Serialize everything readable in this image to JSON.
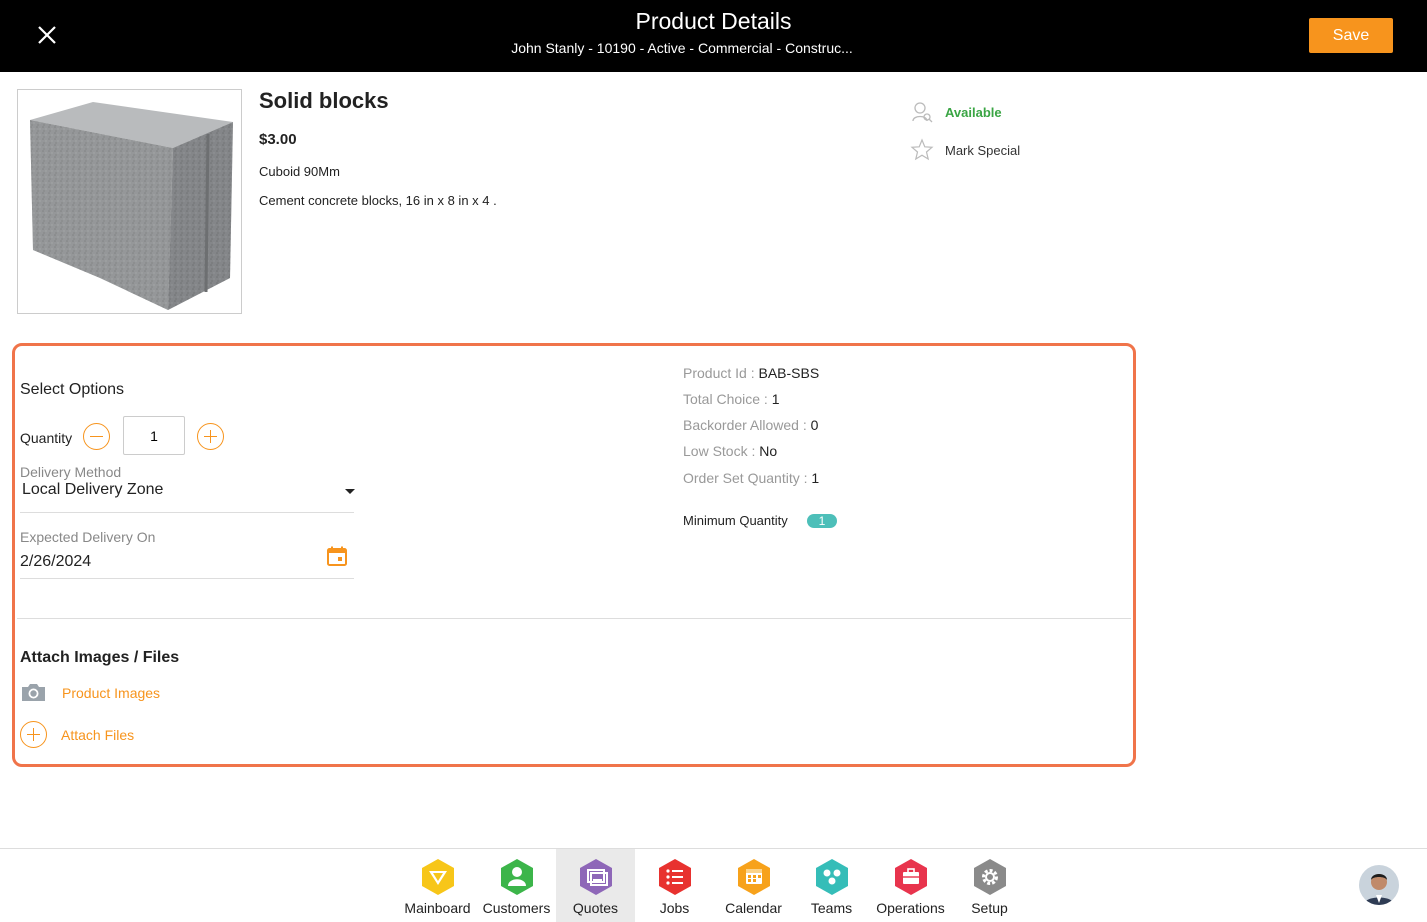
{
  "header": {
    "title": "Product Details",
    "subtitle": "John Stanly - 10190 - Active - Commercial - Construc...",
    "save_label": "Save",
    "close_icon": "close-icon"
  },
  "product": {
    "name": "Solid blocks",
    "price": "$3.00",
    "variant": "Cuboid 90Mm",
    "description": "Cement concrete blocks, 16 in x 8 in x 4 .",
    "availability": "Available",
    "mark_special": "Mark Special"
  },
  "options": {
    "title": "Select Options",
    "quantity_label": "Quantity",
    "quantity_value": "1",
    "delivery_method_label": "Delivery Method",
    "delivery_method_value": "Local Delivery Zone",
    "expected_delivery_label": "Expected Delivery On",
    "expected_delivery_value": "2/26/2024"
  },
  "info": {
    "product_id_label": "Product Id : ",
    "product_id_value": "BAB-SBS",
    "total_choice_label": "Total Choice : ",
    "total_choice_value": "1",
    "backorder_label": "Backorder Allowed : ",
    "backorder_value": "0",
    "low_stock_label": "Low Stock : ",
    "low_stock_value": "No",
    "order_set_label": "Order Set Quantity : ",
    "order_set_value": "1",
    "min_qty_label": "Minimum Quantity",
    "min_qty_value": "1"
  },
  "attachments": {
    "title": "Attach Images / Files",
    "product_images": "Product Images",
    "attach_files": "Attach Files"
  },
  "nav": {
    "items": [
      {
        "label": "Mainboard",
        "color": "#f7c619",
        "icon": "mainboard-icon"
      },
      {
        "label": "Customers",
        "color": "#3cb54a",
        "icon": "customers-icon"
      },
      {
        "label": "Quotes",
        "color": "#8e67b8",
        "icon": "quotes-icon",
        "active": true
      },
      {
        "label": "Jobs",
        "color": "#e8322f",
        "icon": "jobs-icon"
      },
      {
        "label": "Calendar",
        "color": "#f7a21b",
        "icon": "calendar-icon"
      },
      {
        "label": "Teams",
        "color": "#35bdb8",
        "icon": "teams-icon"
      },
      {
        "label": "Operations",
        "color": "#e8344d",
        "icon": "operations-icon"
      },
      {
        "label": "Setup",
        "color": "#8a8a8a",
        "icon": "setup-icon"
      }
    ]
  },
  "colors": {
    "accent": "#f7941d",
    "panel_border": "#f0744a",
    "available": "#3aa544",
    "badge": "#4dbfb9"
  }
}
